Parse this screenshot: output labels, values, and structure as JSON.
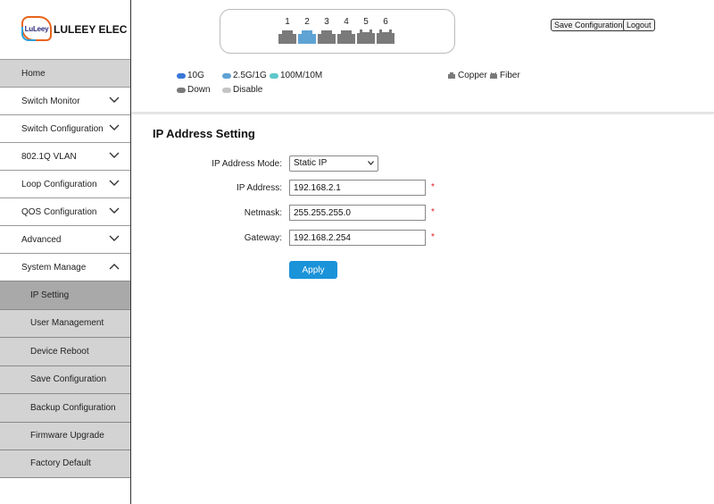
{
  "logo": {
    "badge_text": "LuLeey",
    "brand": "LULEEY ELEC"
  },
  "sidebar": {
    "items": [
      {
        "label": "Home"
      },
      {
        "label": "Switch Monitor"
      },
      {
        "label": "Switch Configuration"
      },
      {
        "label": "802.1Q VLAN"
      },
      {
        "label": "Loop Configuration"
      },
      {
        "label": "QOS Configuration"
      },
      {
        "label": "Advanced"
      },
      {
        "label": "System Manage"
      }
    ],
    "sub_items": [
      {
        "label": "IP Setting"
      },
      {
        "label": "User Management"
      },
      {
        "label": "Device Reboot"
      },
      {
        "label": "Save Configuration"
      },
      {
        "label": "Backup Configuration"
      },
      {
        "label": "Firmware Upgrade"
      },
      {
        "label": "Factory Default"
      }
    ]
  },
  "ports": [
    {
      "number": "1",
      "status": "down"
    },
    {
      "number": "2",
      "status": "2.5G/1G"
    },
    {
      "number": "3",
      "status": "down"
    },
    {
      "number": "4",
      "status": "down"
    },
    {
      "number": "5",
      "status": "down"
    },
    {
      "number": "6",
      "status": "down"
    }
  ],
  "header": {
    "save_label": "Save Configuration",
    "logout_label": "Logout"
  },
  "legend": {
    "speed_10g": "10G",
    "speed_2_5g": "2.5G/1G",
    "speed_100m": "100M/10M",
    "down": "Down",
    "disable": "Disable",
    "copper": "Copper",
    "fiber": "Fiber"
  },
  "colors": {
    "speed_10g": "#3a78d8",
    "speed_2_5g": "#5fa3d4",
    "speed_100m": "#5fc7c9",
    "down": "#7a7a7a",
    "disable": "#c4c4c4",
    "accent": "#1a93d9",
    "required": "#e02020"
  },
  "main": {
    "title": "IP Address Setting",
    "mode_label": "IP Address Mode:",
    "mode_value": "Static IP",
    "ip_label": "IP Address:",
    "ip_value": "192.168.2.1",
    "netmask_label": "Netmask:",
    "netmask_value": "255.255.255.0",
    "gateway_label": "Gateway:",
    "gateway_value": "192.168.2.254",
    "required_mark": "*",
    "apply_label": "Apply"
  }
}
